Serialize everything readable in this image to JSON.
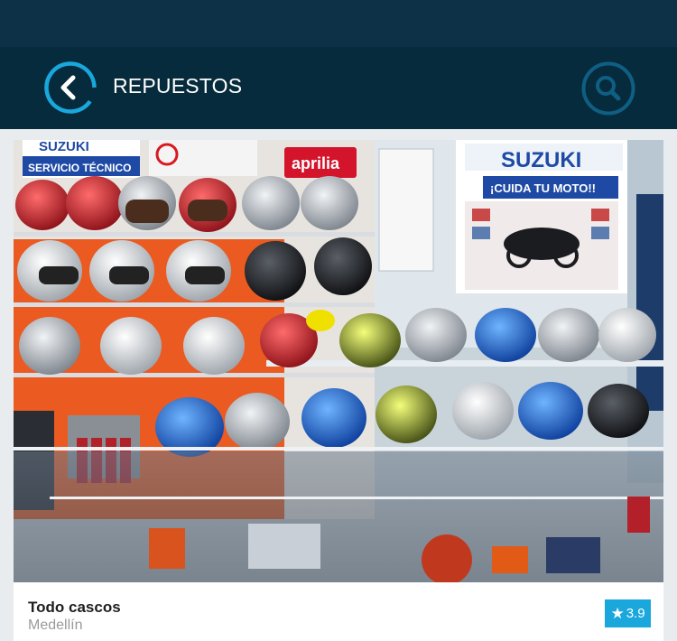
{
  "header": {
    "title": "REPUESTOS",
    "back_icon": "chevron-left-circle-icon",
    "search_icon": "search-icon",
    "background": "#062b3d",
    "accent": "#19a7dc"
  },
  "listing": {
    "name": "Todo cascos",
    "city": "Medellín",
    "rating": "3.9",
    "rating_icon": "star-icon",
    "photo": {
      "brand_sign_left": "SUZUKI",
      "service_sign": "SERVICIO TÉCNICO",
      "brand_sign_center": "aprilia",
      "brand_sign_right": "SUZUKI",
      "poster_slogan": "¡CUIDA TU MOTO!!"
    }
  }
}
